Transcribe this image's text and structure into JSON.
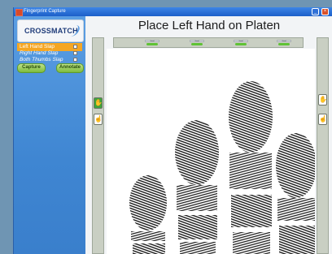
{
  "window": {
    "title": "Fingerprint Capture"
  },
  "sidebar": {
    "logo_text": "CROSSMATCH",
    "menu": [
      {
        "label": "Left Hand Slap",
        "active": true
      },
      {
        "label": "Right Hand Slap",
        "active": false
      },
      {
        "label": "Both Thumbs Slap",
        "active": false
      }
    ],
    "capture_label": "Capture",
    "annotate_label": "Annotate"
  },
  "main": {
    "title": "Place Left Hand on Platen",
    "finger_slots": [
      "Good",
      "Good",
      "Good",
      "Good"
    ]
  },
  "colors": {
    "accent": "#f5a623",
    "status_good": "#5fc236",
    "window_blue": "#4a8fd8"
  },
  "icons": {
    "left_hand": "left-hand-icon",
    "left_thumb": "left-thumb-icon",
    "right_hand": "right-hand-icon",
    "right_thumb": "right-thumb-icon"
  }
}
